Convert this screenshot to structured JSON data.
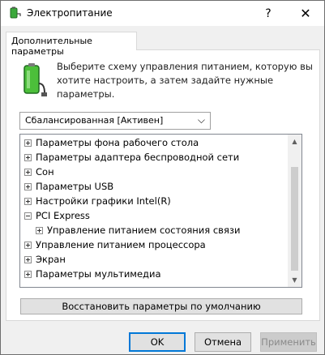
{
  "window": {
    "title": "Электропитание",
    "help_glyph": "?",
    "close_glyph": "✕",
    "icon": "power-options-icon"
  },
  "tab": {
    "label": "Дополнительные параметры"
  },
  "intro": {
    "text": "Выберите схему управления питанием, которую вы хотите настроить, а затем задайте нужные параметры.",
    "icon": "battery-plug-icon"
  },
  "plan_select": {
    "value": "Сбалансированная [Активен]"
  },
  "tree": {
    "items": [
      {
        "label": "Параметры фона рабочего стола",
        "expander": "plus",
        "level": 0
      },
      {
        "label": "Параметры адаптера беспроводной сети",
        "expander": "plus",
        "level": 0
      },
      {
        "label": "Сон",
        "expander": "plus",
        "level": 0
      },
      {
        "label": "Параметры USB",
        "expander": "plus",
        "level": 0
      },
      {
        "label": "Настройки графики Intel(R)",
        "expander": "plus",
        "level": 0
      },
      {
        "label": "PCI Express",
        "expander": "minus",
        "level": 0
      },
      {
        "label": "Управление питанием состояния связи",
        "expander": "plus",
        "level": 1
      },
      {
        "label": "Управление питанием процессора",
        "expander": "plus",
        "level": 0
      },
      {
        "label": "Экран",
        "expander": "plus",
        "level": 0
      },
      {
        "label": "Параметры мультимедиа",
        "expander": "plus",
        "level": 0
      }
    ]
  },
  "restore_button": {
    "label": "Восстановить параметры по умолчанию"
  },
  "footer": {
    "ok": "OK",
    "cancel": "Отмена",
    "apply": "Применить"
  }
}
